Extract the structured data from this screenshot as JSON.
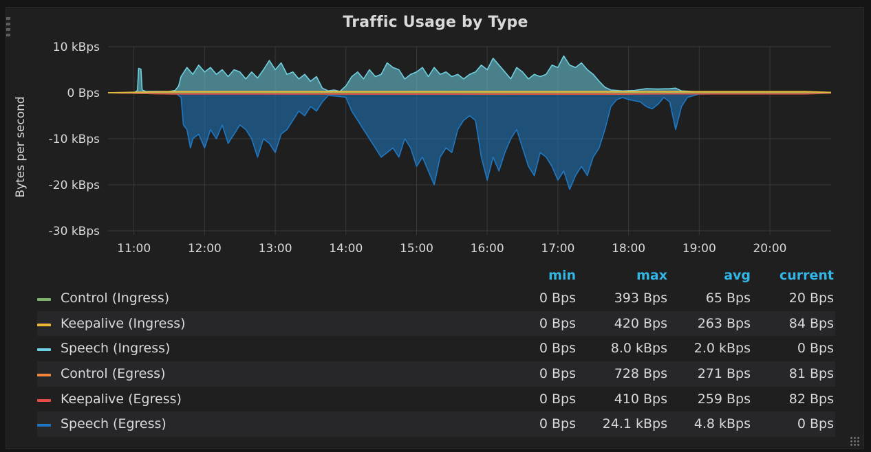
{
  "panel": {
    "title": "Traffic Usage by Type",
    "y_axis_label": "Bytes per second"
  },
  "legend": {
    "headers": {
      "min": "min",
      "max": "max",
      "avg": "avg",
      "current": "current"
    },
    "rows": [
      {
        "name": "Control (Ingress)",
        "color": "#7eb26d",
        "min": "0 Bps",
        "max": "393 Bps",
        "avg": "65 Bps",
        "current": "20 Bps"
      },
      {
        "name": "Keepalive (Ingress)",
        "color": "#eab839",
        "min": "0 Bps",
        "max": "420 Bps",
        "avg": "263 Bps",
        "current": "84 Bps"
      },
      {
        "name": "Speech (Ingress)",
        "color": "#6ed0e0",
        "min": "0 Bps",
        "max": "8.0 kBps",
        "avg": "2.0 kBps",
        "current": "0 Bps"
      },
      {
        "name": "Control (Egress)",
        "color": "#ef843c",
        "min": "0 Bps",
        "max": "728 Bps",
        "avg": "271 Bps",
        "current": "81 Bps"
      },
      {
        "name": "Keepalive (Egress)",
        "color": "#e24d42",
        "min": "0 Bps",
        "max": "410 Bps",
        "avg": "259 Bps",
        "current": "82 Bps"
      },
      {
        "name": "Speech (Egress)",
        "color": "#1f78c1",
        "min": "0 Bps",
        "max": "24.1 kBps",
        "avg": "4.8 kBps",
        "current": "0 Bps"
      }
    ]
  },
  "chart_data": {
    "type": "area",
    "title": "Traffic Usage by Type",
    "xlabel": "",
    "ylabel": "Bytes per second",
    "x_range": [
      "10:38",
      "20:52"
    ],
    "y_range_kBps": [
      -30,
      10
    ],
    "x_ticks": [
      "11:00",
      "12:00",
      "13:00",
      "14:00",
      "15:00",
      "16:00",
      "17:00",
      "18:00",
      "19:00",
      "20:00"
    ],
    "y_ticks": [
      {
        "value": 10,
        "label": "10 kBps"
      },
      {
        "value": 0,
        "label": "0 Bps"
      },
      {
        "value": -10,
        "label": "-10 kBps"
      },
      {
        "value": -20,
        "label": "-20 kBps"
      },
      {
        "value": -30,
        "label": "-30 kBps"
      }
    ],
    "grid": true,
    "legend_position": "bottom",
    "series": [
      {
        "name": "Speech (Ingress)",
        "color": "#6ed0e0",
        "unit": "kBps",
        "points": [
          [
            "10:38",
            0
          ],
          [
            "11:00",
            0
          ],
          [
            "11:03",
            0.5
          ],
          [
            "11:04",
            5.3
          ],
          [
            "11:06",
            5.1
          ],
          [
            "11:07",
            0.6
          ],
          [
            "11:10",
            0.3
          ],
          [
            "11:30",
            0.3
          ],
          [
            "11:35",
            0.5
          ],
          [
            "11:38",
            1.5
          ],
          [
            "11:40",
            3.5
          ],
          [
            "11:45",
            5.5
          ],
          [
            "11:50",
            4
          ],
          [
            "11:55",
            6
          ],
          [
            "12:00",
            4.5
          ],
          [
            "12:05",
            5.5
          ],
          [
            "12:10",
            4
          ],
          [
            "12:15",
            5
          ],
          [
            "12:20",
            3.5
          ],
          [
            "12:25",
            5
          ],
          [
            "12:30",
            4.5
          ],
          [
            "12:35",
            3
          ],
          [
            "12:40",
            4.5
          ],
          [
            "12:45",
            3.2
          ],
          [
            "12:50",
            5
          ],
          [
            "12:55",
            7
          ],
          [
            "13:00",
            5
          ],
          [
            "13:05",
            6.5
          ],
          [
            "13:10",
            4
          ],
          [
            "13:15",
            4.5
          ],
          [
            "13:20",
            3
          ],
          [
            "13:25",
            4
          ],
          [
            "13:30",
            2.5
          ],
          [
            "13:35",
            3.5
          ],
          [
            "13:40",
            1
          ],
          [
            "13:45",
            0.4
          ],
          [
            "13:50",
            0.6
          ],
          [
            "13:55",
            0.3
          ],
          [
            "14:00",
            1.5
          ],
          [
            "14:05",
            3.5
          ],
          [
            "14:10",
            4.5
          ],
          [
            "14:15",
            3
          ],
          [
            "14:20",
            5
          ],
          [
            "14:25",
            3.5
          ],
          [
            "14:30",
            4
          ],
          [
            "14:35",
            6.5
          ],
          [
            "14:40",
            5.5
          ],
          [
            "14:45",
            5
          ],
          [
            "14:50",
            3
          ],
          [
            "14:55",
            4
          ],
          [
            "15:00",
            4.5
          ],
          [
            "15:05",
            5.5
          ],
          [
            "15:10",
            3.5
          ],
          [
            "15:15",
            5.5
          ],
          [
            "15:20",
            4
          ],
          [
            "15:25",
            4.5
          ],
          [
            "15:30",
            3.5
          ],
          [
            "15:35",
            4
          ],
          [
            "15:40",
            3
          ],
          [
            "15:45",
            4
          ],
          [
            "15:50",
            4.5
          ],
          [
            "15:55",
            6
          ],
          [
            "16:00",
            5
          ],
          [
            "16:05",
            7.5
          ],
          [
            "16:10",
            6
          ],
          [
            "16:15",
            4.5
          ],
          [
            "16:20",
            3
          ],
          [
            "16:25",
            5.5
          ],
          [
            "16:30",
            4.5
          ],
          [
            "16:35",
            3
          ],
          [
            "16:40",
            4
          ],
          [
            "16:45",
            3.5
          ],
          [
            "16:50",
            4
          ],
          [
            "16:55",
            6
          ],
          [
            "17:00",
            5.5
          ],
          [
            "17:05",
            8
          ],
          [
            "17:10",
            6
          ],
          [
            "17:15",
            5.5
          ],
          [
            "17:20",
            6.5
          ],
          [
            "17:25",
            5
          ],
          [
            "17:30",
            4
          ],
          [
            "17:35",
            2.5
          ],
          [
            "17:40",
            1.2
          ],
          [
            "17:45",
            0.6
          ],
          [
            "17:55",
            0.4
          ],
          [
            "18:05",
            0.5
          ],
          [
            "18:15",
            0.9
          ],
          [
            "18:25",
            0.8
          ],
          [
            "18:35",
            0.9
          ],
          [
            "18:40",
            1
          ],
          [
            "18:45",
            0.4
          ],
          [
            "19:00",
            0.2
          ],
          [
            "20:00",
            0.2
          ],
          [
            "20:52",
            0.1
          ]
        ]
      },
      {
        "name": "Speech (Egress)",
        "color": "#1f78c1",
        "unit": "kBps",
        "points": [
          [
            "10:38",
            0
          ],
          [
            "11:35",
            0
          ],
          [
            "11:40",
            -1
          ],
          [
            "11:42",
            -7
          ],
          [
            "11:45",
            -8
          ],
          [
            "11:48",
            -12
          ],
          [
            "11:50",
            -10
          ],
          [
            "11:55",
            -9
          ],
          [
            "12:00",
            -12
          ],
          [
            "12:05",
            -8
          ],
          [
            "12:10",
            -10
          ],
          [
            "12:15",
            -7
          ],
          [
            "12:20",
            -11
          ],
          [
            "12:25",
            -9
          ],
          [
            "12:30",
            -7
          ],
          [
            "12:35",
            -8
          ],
          [
            "12:40",
            -10
          ],
          [
            "12:45",
            -14
          ],
          [
            "12:50",
            -10
          ],
          [
            "12:55",
            -11
          ],
          [
            "13:00",
            -13
          ],
          [
            "13:05",
            -9
          ],
          [
            "13:10",
            -8
          ],
          [
            "13:15",
            -6
          ],
          [
            "13:20",
            -4
          ],
          [
            "13:25",
            -5
          ],
          [
            "13:30",
            -3
          ],
          [
            "13:35",
            -4
          ],
          [
            "13:40",
            -2
          ],
          [
            "13:45",
            -0.6
          ],
          [
            "13:55",
            -0.8
          ],
          [
            "14:00",
            -1
          ],
          [
            "14:05",
            -4
          ],
          [
            "14:10",
            -6
          ],
          [
            "14:15",
            -8
          ],
          [
            "14:20",
            -10
          ],
          [
            "14:25",
            -12
          ],
          [
            "14:30",
            -14
          ],
          [
            "14:35",
            -13
          ],
          [
            "14:40",
            -12
          ],
          [
            "14:45",
            -14
          ],
          [
            "14:50",
            -10
          ],
          [
            "14:55",
            -12
          ],
          [
            "15:00",
            -16
          ],
          [
            "15:05",
            -14
          ],
          [
            "15:10",
            -17
          ],
          [
            "15:15",
            -20
          ],
          [
            "15:20",
            -14
          ],
          [
            "15:25",
            -12
          ],
          [
            "15:30",
            -13
          ],
          [
            "15:35",
            -8
          ],
          [
            "15:40",
            -6
          ],
          [
            "15:45",
            -5
          ],
          [
            "15:50",
            -6
          ],
          [
            "15:55",
            -14
          ],
          [
            "16:00",
            -19
          ],
          [
            "16:05",
            -14
          ],
          [
            "16:10",
            -17
          ],
          [
            "16:15",
            -13
          ],
          [
            "16:20",
            -10
          ],
          [
            "16:25",
            -8
          ],
          [
            "16:30",
            -12
          ],
          [
            "16:35",
            -16
          ],
          [
            "16:40",
            -18
          ],
          [
            "16:45",
            -13
          ],
          [
            "16:50",
            -14
          ],
          [
            "16:55",
            -16
          ],
          [
            "17:00",
            -19
          ],
          [
            "17:05",
            -17
          ],
          [
            "17:10",
            -21
          ],
          [
            "17:15",
            -18
          ],
          [
            "17:20",
            -16
          ],
          [
            "17:25",
            -18
          ],
          [
            "17:30",
            -14
          ],
          [
            "17:35",
            -12
          ],
          [
            "17:40",
            -8
          ],
          [
            "17:45",
            -3
          ],
          [
            "17:50",
            -1.5
          ],
          [
            "17:55",
            -1
          ],
          [
            "18:00",
            -1.5
          ],
          [
            "18:10",
            -2
          ],
          [
            "18:15",
            -3
          ],
          [
            "18:20",
            -3.5
          ],
          [
            "18:25",
            -2.5
          ],
          [
            "18:30",
            -1
          ],
          [
            "18:35",
            -2
          ],
          [
            "18:40",
            -8
          ],
          [
            "18:45",
            -3
          ],
          [
            "18:50",
            -1
          ],
          [
            "19:00",
            -0.3
          ],
          [
            "20:00",
            -0.1
          ],
          [
            "20:52",
            0
          ]
        ]
      },
      {
        "name": "Control (Ingress)",
        "color": "#7eb26d",
        "unit": "kBps",
        "points": [
          [
            "10:38",
            0
          ],
          [
            "11:30",
            0.05
          ],
          [
            "20:52",
            0.02
          ]
        ]
      },
      {
        "name": "Keepalive (Ingress)",
        "color": "#eab839",
        "unit": "kBps",
        "points": [
          [
            "10:38",
            0
          ],
          [
            "11:30",
            0.26
          ],
          [
            "20:30",
            0.26
          ],
          [
            "20:52",
            0.08
          ]
        ]
      },
      {
        "name": "Control (Egress)",
        "color": "#ef843c",
        "unit": "kBps",
        "points": [
          [
            "10:38",
            0
          ],
          [
            "11:30",
            -0.25
          ],
          [
            "17:40",
            -0.3
          ],
          [
            "20:52",
            -0.08
          ]
        ]
      },
      {
        "name": "Keepalive (Egress)",
        "color": "#e24d42",
        "unit": "kBps",
        "points": [
          [
            "10:38",
            0
          ],
          [
            "11:30",
            -0.26
          ],
          [
            "20:30",
            -0.26
          ],
          [
            "20:52",
            -0.08
          ]
        ]
      }
    ]
  }
}
